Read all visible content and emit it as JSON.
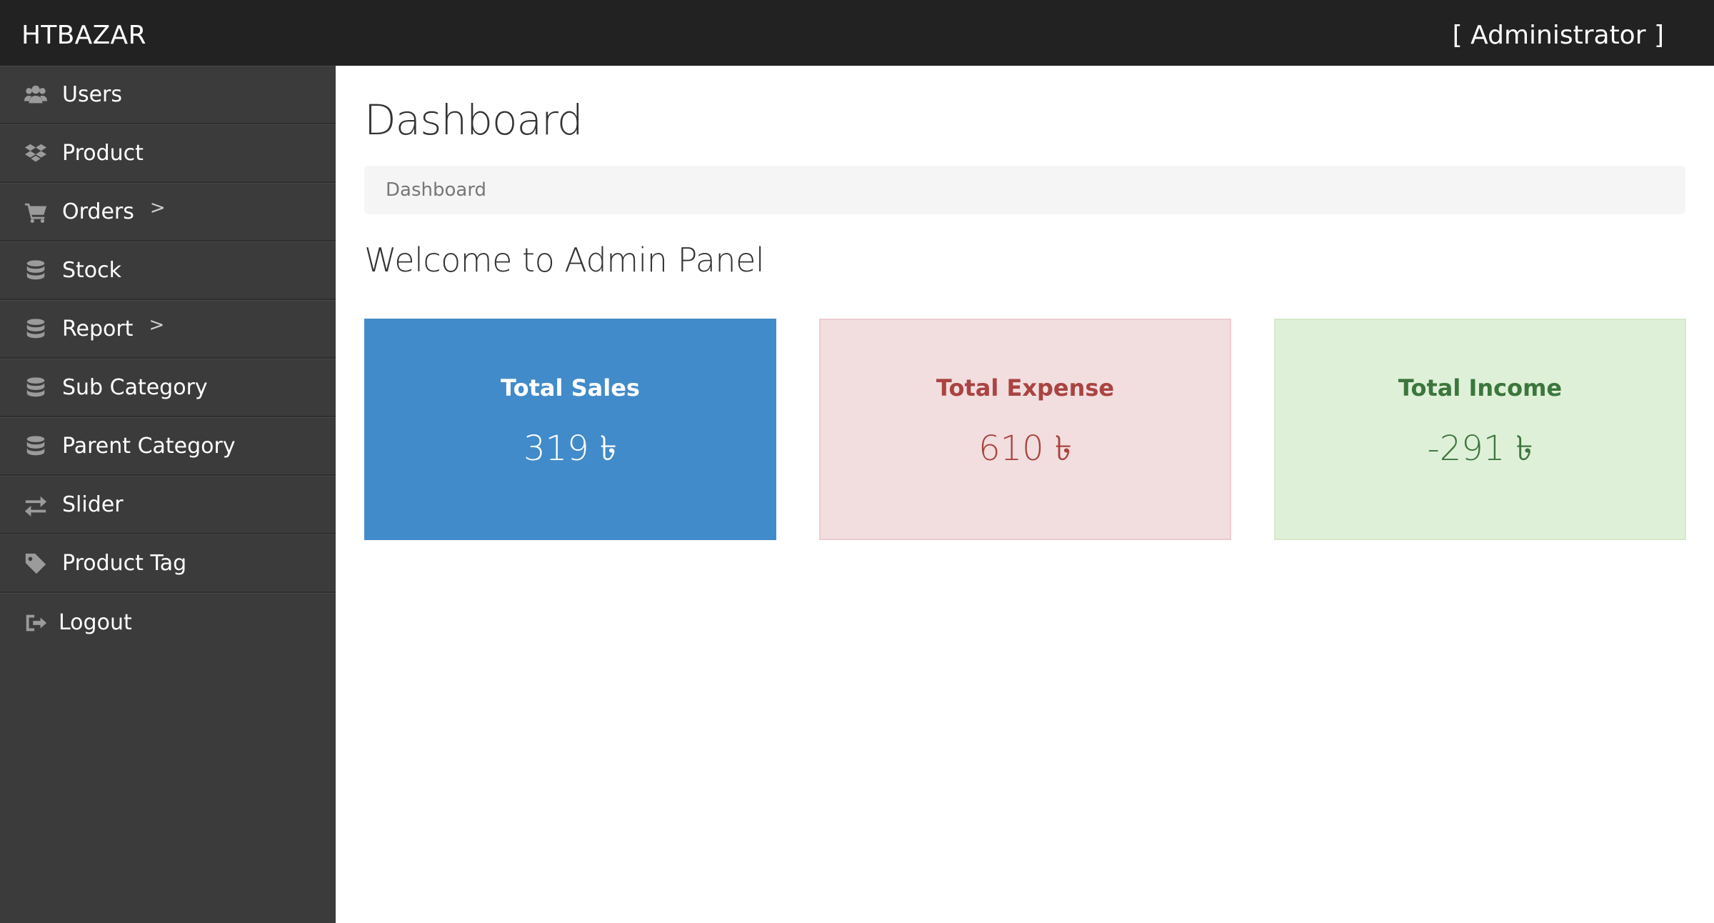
{
  "app": {
    "brand": "HTBAZAR",
    "user_label": "[ Administrator ]"
  },
  "sidebar": {
    "items": [
      {
        "label": "Users",
        "icon": "users-icon"
      },
      {
        "label": "Product",
        "icon": "dropbox-icon"
      },
      {
        "label": "Orders",
        "icon": "shopping-cart-icon",
        "chevron": ">"
      },
      {
        "label": "Stock",
        "icon": "database-icon"
      },
      {
        "label": "Report",
        "icon": "database-icon",
        "chevron": ">"
      },
      {
        "label": "Sub Category",
        "icon": "database-icon"
      },
      {
        "label": "Parent Category",
        "icon": "database-icon"
      },
      {
        "label": "Slider",
        "icon": "exchange-icon"
      },
      {
        "label": "Product Tag",
        "icon": "tag-icon"
      },
      {
        "label": "Logout",
        "icon": "sign-out-icon"
      }
    ]
  },
  "main": {
    "title": "Dashboard",
    "breadcrumb": "Dashboard",
    "welcome": "Welcome to Admin Panel",
    "cards": [
      {
        "title": "Total Sales",
        "value": "319 ৳"
      },
      {
        "title": "Total Expense",
        "value": "610 ৳"
      },
      {
        "title": "Total Income",
        "value": "-291 ৳"
      }
    ]
  },
  "colors": {
    "topbar": "#222222",
    "sidebar": "#3b3b3b",
    "sales_bg": "#428bca",
    "expense_bg": "#f2dede",
    "expense_text": "#a94442",
    "income_bg": "#dff0d8",
    "income_text": "#3c763d"
  }
}
